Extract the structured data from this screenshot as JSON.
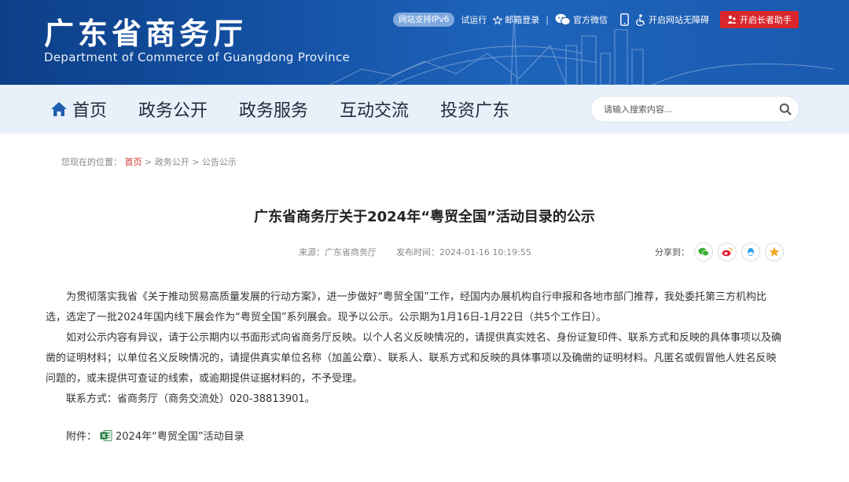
{
  "header": {
    "title": "广东省商务厅",
    "subtitle": "Department of Commerce of Guangdong Province",
    "ipv6_badge": "网站支持IPv6",
    "trial": "试运行",
    "mail_login": "邮箱登录",
    "separator": "|",
    "wechat": "官方微信",
    "accessibility": "开启网站无障碍",
    "elder_mode": "开启长者助手"
  },
  "nav": {
    "items": [
      {
        "label": "首页"
      },
      {
        "label": "政务公开"
      },
      {
        "label": "政务服务"
      },
      {
        "label": "互动交流"
      },
      {
        "label": "投资广东"
      }
    ],
    "search_placeholder": "请输入搜索内容..."
  },
  "breadcrumb": {
    "prefix": "您现在的位置：",
    "home": "首页",
    "sep": " > ",
    "level1": "政务公开",
    "level2": "公告公示"
  },
  "article": {
    "title": "广东省商务厅关于2024年“粤贸全国”活动目录的公示",
    "source_label": "来源：",
    "source": "广东省商务厅",
    "time_label": "发布时间：",
    "time": "2024-01-16 10:19:55",
    "share_label": "分享到：",
    "paragraphs": [
      "为贯彻落实我省《关于推动贸易高质量发展的行动方案》，进一步做好“粤贸全国”工作，经国内办展机构自行申报和各地市部门推荐，我处委托第三方机构比选，选定了一批2024年国内线下展会作为“粤贸全国”系列展会。现予以公示。公示期为1月16日-1月22日（共5个工作日）。",
      "如对公示内容有异议，请于公示期内以书面形式向省商务厅反映。以个人名义反映情况的，请提供真实姓名、身份证复印件、联系方式和反映的具体事项以及确凿的证明材料；以单位名义反映情况的，请提供真实单位名称（加盖公章）、联系人、联系方式和反映的具体事项以及确凿的证明材料。凡匿名或假冒他人姓名反映问题的，或未提供可查证的线索，或逾期提供证据材料的，不予受理。",
      "联系方式：省商务厅（商务交流处）020-38813901。"
    ],
    "attachment_label": "附件：",
    "attachment_name": "2024年“粤贸全国”活动目录"
  },
  "colors": {
    "banner": "#1553a6",
    "nav_bg": "#e8f1fa",
    "accent_red": "#d9262c"
  }
}
